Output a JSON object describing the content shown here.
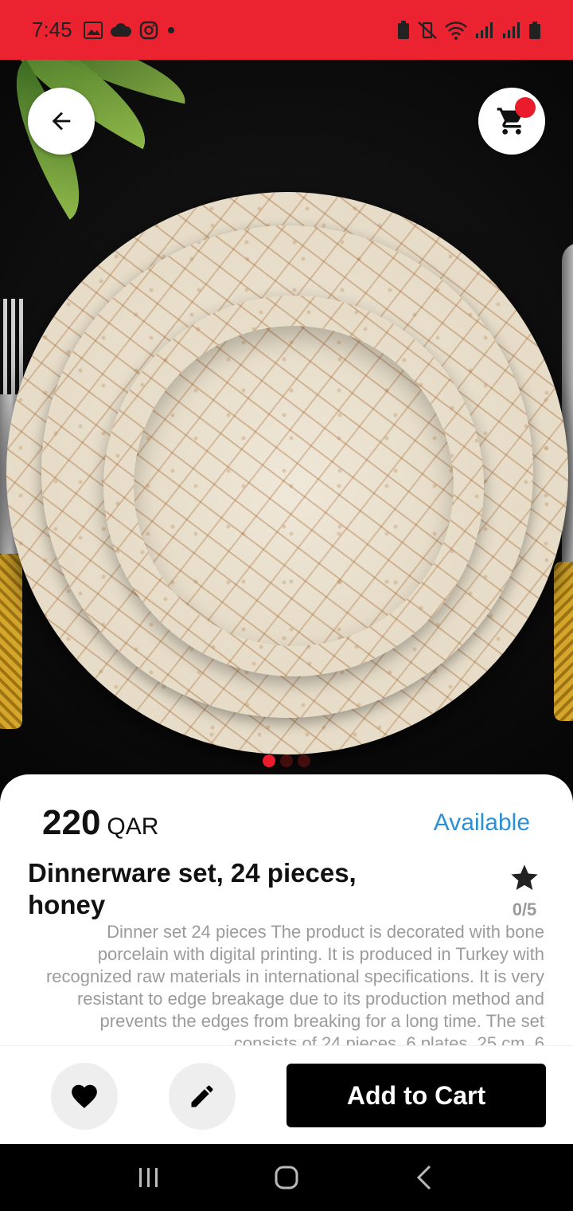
{
  "status_bar": {
    "time": "7:45",
    "left_icons": [
      "gallery-icon",
      "cloud-icon",
      "instagram-icon",
      "dot-icon"
    ],
    "right_icons": [
      "battery-saver-icon",
      "vibrate-off-icon",
      "wifi-icon",
      "signal-icon",
      "signal-icon",
      "battery-icon"
    ],
    "background": "#eb2330"
  },
  "hero": {
    "image": "dinnerware-plates-photo",
    "carousel": {
      "count": 3,
      "active": 0
    }
  },
  "header": {
    "back_icon": "arrow-left-icon",
    "cart_icon": "shopping-cart-icon",
    "cart_badge_color": "#ea1c2b"
  },
  "product": {
    "price": "220",
    "currency": "QAR",
    "availability": "Available",
    "title": "Dinnerware set, 24 pieces, honey",
    "rating": "0/5",
    "rating_icon": "star-icon",
    "description": "Dinner set 24 pieces The product is decorated with bone porcelain with digital printing. It is produced in Turkey with recognized raw materials in international specifications. It is very resistant to edge breakage due to its production method and prevents the edges from breaking for a long time. The set consists of 24 pieces, 6 plates, 25 cm, 6"
  },
  "actions": {
    "favorite_icon": "heart-icon",
    "edit_icon": "pencil-icon",
    "add_to_cart_label": "Add to Cart"
  },
  "nav": {
    "items": [
      "recent-apps-icon",
      "home-icon",
      "back-icon"
    ]
  },
  "colors": {
    "accent": "#ea1c2b",
    "available": "#2a91d8"
  }
}
